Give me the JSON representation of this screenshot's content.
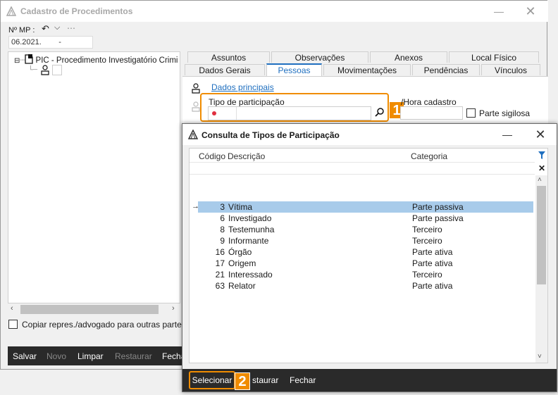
{
  "main_window": {
    "title": "Cadastro de Procedimentos",
    "mp_label": "Nº MP :",
    "mp_value": "06.2021.        -",
    "tree_root": "PIC - Procedimento Investigatório Crimi",
    "copiar_label": "Copiar repres./advogado para outras partes",
    "footer": {
      "salvar": "Salvar",
      "novo": "Novo",
      "limpar": "Limpar",
      "restaurar": "Restaurar",
      "fechar": "Fecha"
    },
    "tabs_row1": [
      "Assuntos",
      "Observações",
      "Anexos",
      "Local Físico"
    ],
    "tabs_row2": [
      "Dados Gerais",
      "Pessoas",
      "Movimentações",
      "Pendências",
      "Vínculos"
    ],
    "active_tab": "Pessoas",
    "dados_principais": "Dados principais",
    "tipo_label": "Tipo de participação",
    "hora_label": "/Hora cadastro",
    "parte_sigilosa": "Parte sigilosa"
  },
  "callouts": {
    "one": "1",
    "two": "2"
  },
  "colors": {
    "accent_orange": "#f08c00",
    "link_blue": "#1f6fbf",
    "selected_row": "#a8cbea",
    "footer_dark": "#2a2a2a"
  },
  "modal": {
    "title": "Consulta de Tipos de Participação",
    "columns": {
      "codigo": "Código",
      "descricao": "Descrição",
      "categoria": "Categoria"
    },
    "rows": [
      {
        "codigo": "3",
        "descricao": "Vítima",
        "categoria": "Parte passiva"
      },
      {
        "codigo": "6",
        "descricao": "Investigado",
        "categoria": "Parte passiva"
      },
      {
        "codigo": "8",
        "descricao": "Testemunha",
        "categoria": "Terceiro"
      },
      {
        "codigo": "9",
        "descricao": "Informante",
        "categoria": "Terceiro"
      },
      {
        "codigo": "16",
        "descricao": "Órgão",
        "categoria": "Parte ativa"
      },
      {
        "codigo": "17",
        "descricao": "Origem",
        "categoria": "Parte ativa"
      },
      {
        "codigo": "21",
        "descricao": "Interessado",
        "categoria": "Terceiro"
      },
      {
        "codigo": "63",
        "descricao": "Relator",
        "categoria": "Parte ativa"
      }
    ],
    "selected_index": 0,
    "footer": {
      "selecionar": "Selecionar",
      "restaurar": "staurar",
      "fechar": "Fechar"
    }
  }
}
